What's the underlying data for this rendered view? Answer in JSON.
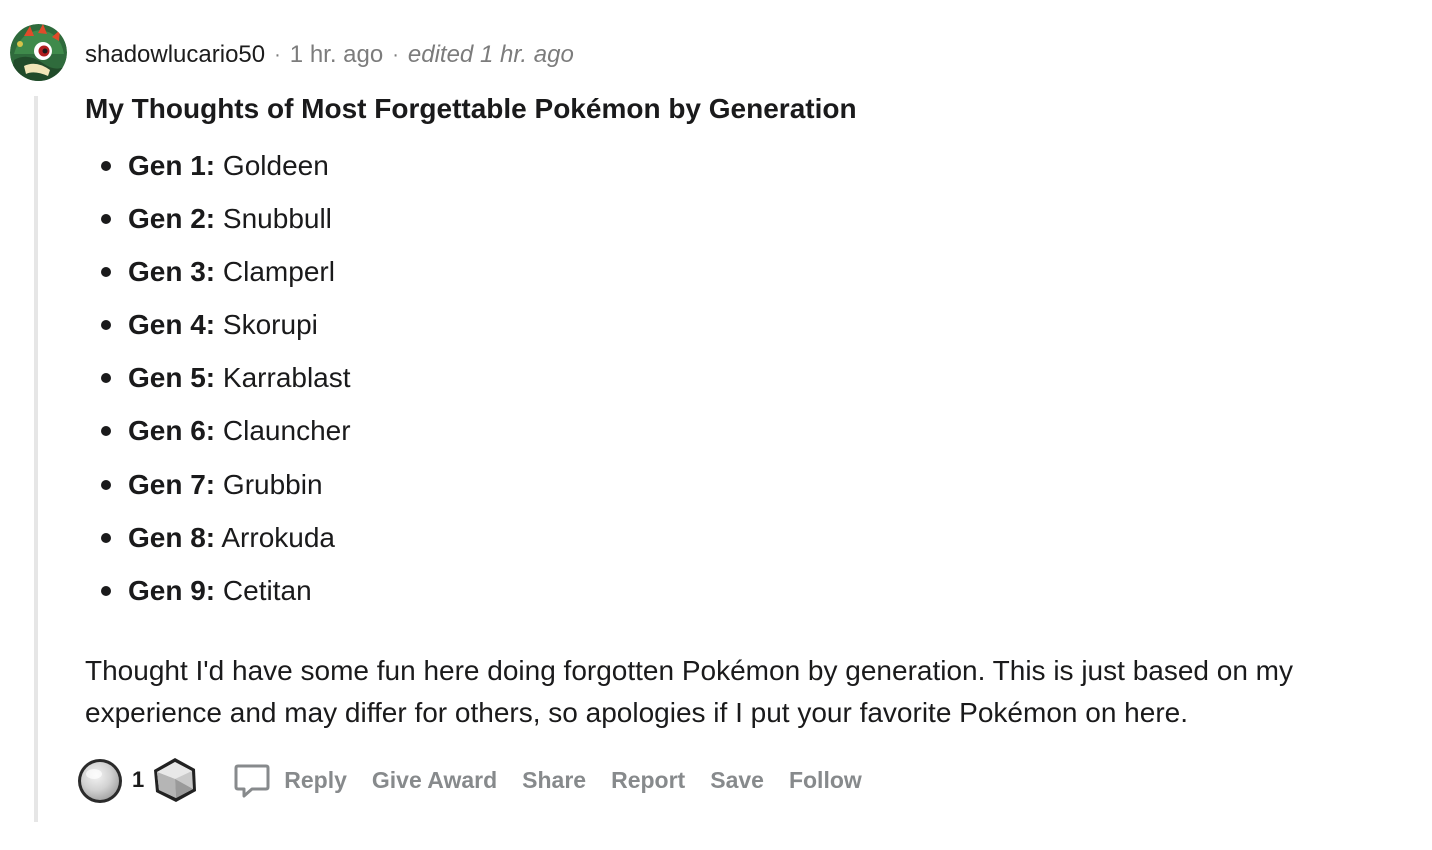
{
  "comment": {
    "author": "shadowlucario50",
    "posted": "1 hr. ago",
    "edited": "edited 1 hr. ago",
    "separator": "·",
    "heading": "My Thoughts of Most Forgettable Pokémon by Generation",
    "generations": [
      {
        "label": "Gen 1:",
        "pokemon": "Goldeen"
      },
      {
        "label": "Gen 2:",
        "pokemon": "Snubbull"
      },
      {
        "label": "Gen 3:",
        "pokemon": "Clamperl"
      },
      {
        "label": "Gen 4:",
        "pokemon": "Skorupi"
      },
      {
        "label": "Gen 5:",
        "pokemon": "Karrablast"
      },
      {
        "label": "Gen 6:",
        "pokemon": "Clauncher"
      },
      {
        "label": "Gen 7:",
        "pokemon": "Grubbin"
      },
      {
        "label": "Gen 8:",
        "pokemon": "Arrokuda"
      },
      {
        "label": "Gen 9:",
        "pokemon": "Cetitan"
      }
    ],
    "body": "Thought I'd have some fun here doing forgotten Pokémon by generation. This is just based on my experience and may differ for others, so apologies if I put your favorite Pokémon on here."
  },
  "actions": {
    "award_count": "1",
    "reply": "Reply",
    "give_award": "Give Award",
    "share": "Share",
    "report": "Report",
    "save": "Save",
    "follow": "Follow"
  },
  "icons": {
    "avatar": "avatar-creature-icon",
    "silver_award": "silver-award-icon",
    "gem_award": "gem-award-icon",
    "reply": "comment-bubble-icon"
  },
  "colors": {
    "action_gray": "#878a8c",
    "meta_gray": "#7c7c7c",
    "thread_line": "#e6e6e6",
    "text": "#1a1a1b"
  }
}
